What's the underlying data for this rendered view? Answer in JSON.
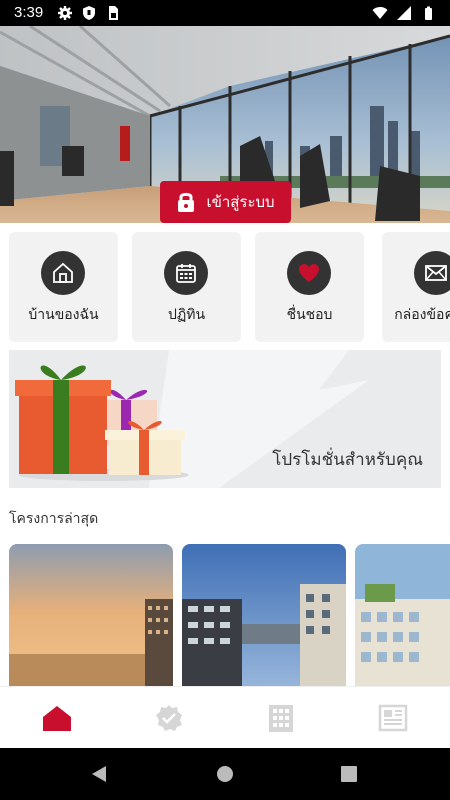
{
  "status_bar": {
    "time": "3:39",
    "icons": [
      "gear-icon",
      "shield-icon",
      "sim-card-icon",
      "wifi-icon",
      "signal-icon",
      "battery-icon"
    ]
  },
  "hero": {
    "login_label": "เข้าสู่ระบบ",
    "login_icon": "lock-icon"
  },
  "quick_menu": [
    {
      "label": "บ้านของฉัน",
      "icon": "home-icon"
    },
    {
      "label": "ปฏิทิน",
      "icon": "calendar-icon"
    },
    {
      "label": "ชื่นชอบ",
      "icon": "heart-icon"
    },
    {
      "label": "กล่องข้อความ",
      "icon": "mail-icon"
    }
  ],
  "promo": {
    "label": "โปรโมชั่นสำหรับคุณ"
  },
  "latest_projects": {
    "title": "โครงการล่าสุด"
  },
  "bottom_nav": [
    {
      "icon": "home-icon",
      "active": true
    },
    {
      "icon": "check-badge-icon",
      "active": false
    },
    {
      "icon": "building-icon",
      "active": false
    },
    {
      "icon": "news-icon",
      "active": false
    }
  ],
  "colors": {
    "accent": "#c8102e",
    "status_bar": "#000000",
    "card_bg": "#f2f2f2",
    "inactive_icon": "#d6d6d6"
  }
}
